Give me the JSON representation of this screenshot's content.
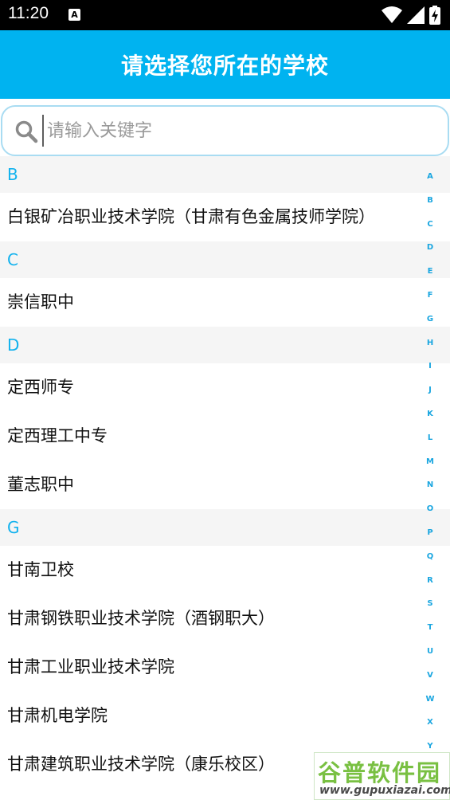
{
  "status_bar": {
    "time": "11:20",
    "notification_badge": "A",
    "icons": [
      "wifi-icon",
      "signal-icon",
      "battery-charging-icon"
    ]
  },
  "header": {
    "title": "请选择您所在的学校",
    "background_color": "#00b3f0"
  },
  "search": {
    "placeholder": "请输入关键字",
    "value": ""
  },
  "sections": [
    {
      "letter": "B",
      "schools": [
        "白银矿冶职业技术学院（甘肃有色金属技师学院）"
      ]
    },
    {
      "letter": "C",
      "schools": [
        "崇信职中"
      ]
    },
    {
      "letter": "D",
      "schools": [
        "定西师专",
        "定西理工中专",
        "董志职中"
      ]
    },
    {
      "letter": "G",
      "schools": [
        "甘南卫校",
        "甘肃钢铁职业技术学院（酒钢职大）",
        "甘肃工业职业技术学院",
        "甘肃机电学院",
        "甘肃建筑职业技术学院（康乐校区）"
      ]
    }
  ],
  "index_letters": [
    "A",
    "B",
    "C",
    "D",
    "E",
    "F",
    "G",
    "H",
    "I",
    "J",
    "K",
    "L",
    "M",
    "N",
    "O",
    "P",
    "Q",
    "R",
    "S",
    "T",
    "U",
    "V",
    "W",
    "X",
    "Y"
  ],
  "watermark": {
    "main": "谷普软件园",
    "sub": "www.gupuxiazai.com"
  },
  "colors": {
    "accent": "#00b3f0",
    "section_text": "#12b2ee",
    "section_bg": "#f5f5f5",
    "index_text": "#1aa6e0"
  }
}
